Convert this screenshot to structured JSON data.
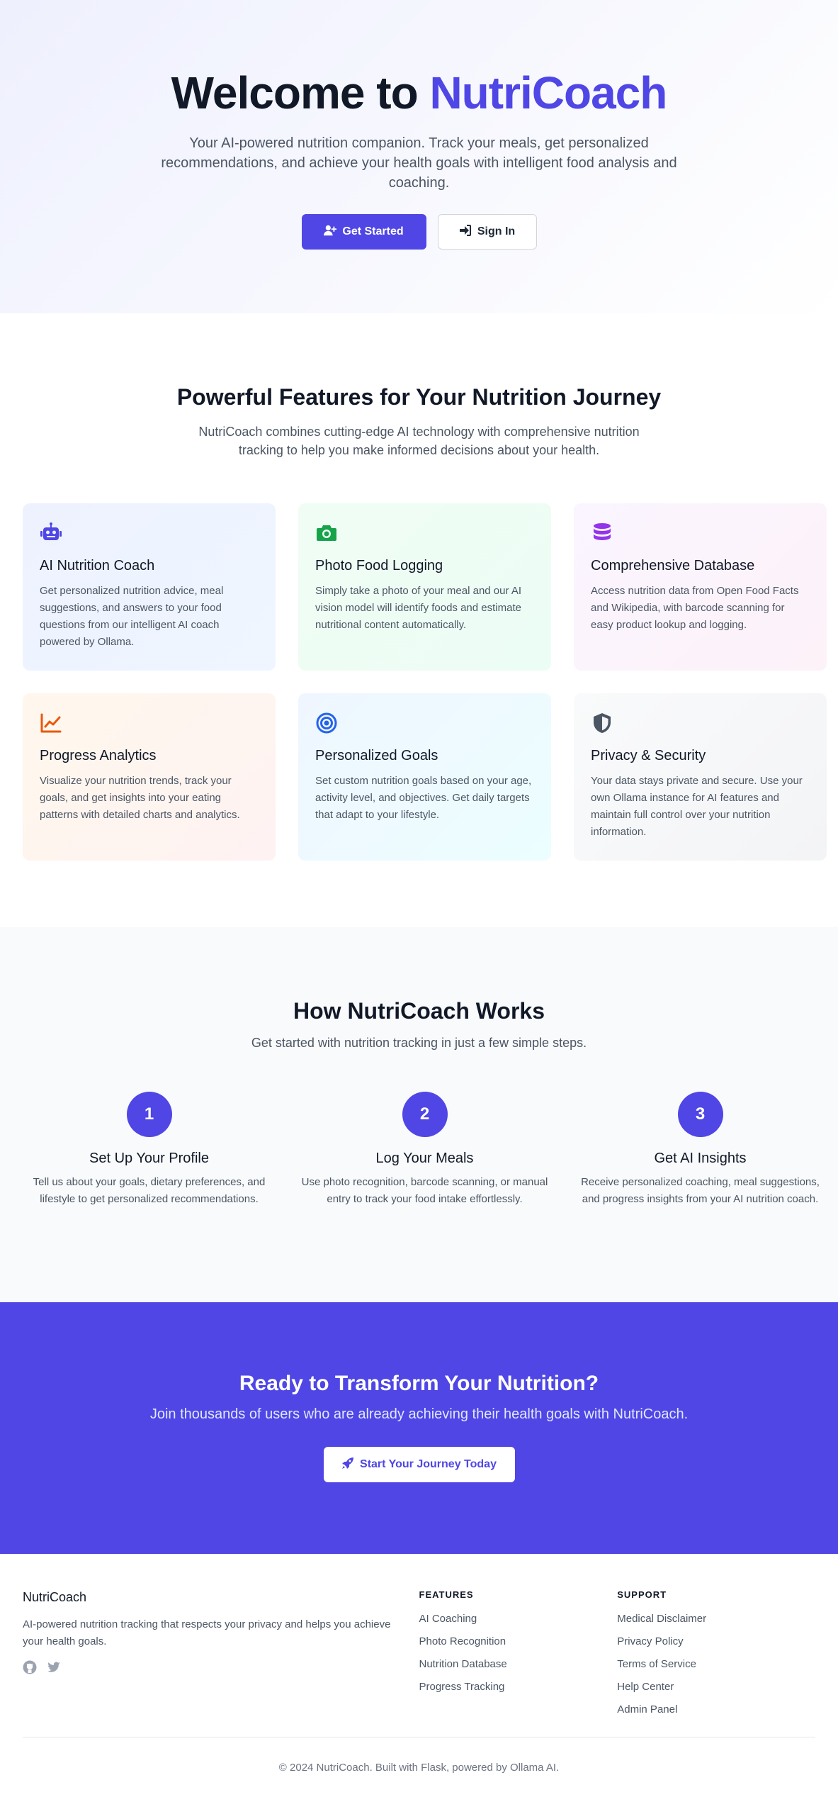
{
  "hero": {
    "title_prefix": "Welcome to ",
    "title_brand": "NutriCoach",
    "subtitle": "Your AI-powered nutrition companion. Track your meals, get personalized recommendations, and achieve your health goals with intelligent food analysis and coaching.",
    "primary_button": "Get Started",
    "secondary_button": "Sign In",
    "primary_icon": "user-plus-icon",
    "secondary_icon": "sign-in-icon"
  },
  "features": {
    "title": "Powerful Features for Your Nutrition Journey",
    "subtitle": "NutriCoach combines cutting-edge AI technology with comprehensive nutrition tracking to help you make informed decisions about your health.",
    "cards": [
      {
        "title": "AI Nutrition Coach",
        "text": "Get personalized nutrition advice, meal suggestions, and answers to your food questions from our intelligent AI coach powered by Ollama.",
        "icon": "robot-icon",
        "color": "#4f46e5"
      },
      {
        "title": "Photo Food Logging",
        "text": "Simply take a photo of your meal and our AI vision model will identify foods and estimate nutritional content automatically.",
        "icon": "camera-icon",
        "color": "#16a34a"
      },
      {
        "title": "Comprehensive Database",
        "text": "Access nutrition data from Open Food Facts and Wikipedia, with barcode scanning for easy product lookup and logging.",
        "icon": "database-icon",
        "color": "#9333ea"
      },
      {
        "title": "Progress Analytics",
        "text": "Visualize your nutrition trends, track your goals, and get insights into your eating patterns with detailed charts and analytics.",
        "icon": "chart-line-icon",
        "color": "#ea580c"
      },
      {
        "title": "Personalized Goals",
        "text": "Set custom nutrition goals based on your age, activity level, and objectives. Get daily targets that adapt to your lifestyle.",
        "icon": "target-icon",
        "color": "#2563eb"
      },
      {
        "title": "Privacy & Security",
        "text": "Your data stays private and secure. Use your own Ollama instance for AI features and maintain full control over your nutrition information.",
        "icon": "shield-icon",
        "color": "#4b5563"
      }
    ]
  },
  "how": {
    "title": "How NutriCoach Works",
    "subtitle": "Get started with nutrition tracking in just a few simple steps.",
    "steps": [
      {
        "num": "1",
        "title": "Set Up Your Profile",
        "text": "Tell us about your goals, dietary preferences, and lifestyle to get personalized recommendations."
      },
      {
        "num": "2",
        "title": "Log Your Meals",
        "text": "Use photo recognition, barcode scanning, or manual entry to track your food intake effortlessly."
      },
      {
        "num": "3",
        "title": "Get AI Insights",
        "text": "Receive personalized coaching, meal suggestions, and progress insights from your AI nutrition coach."
      }
    ]
  },
  "cta": {
    "title": "Ready to Transform Your Nutrition?",
    "subtitle": "Join thousands of users who are already achieving their health goals with NutriCoach.",
    "button": "Start Your Journey Today",
    "button_icon": "rocket-icon"
  },
  "footer": {
    "brand": "NutriCoach",
    "tagline": "AI-powered nutrition tracking that respects your privacy and helps you achieve your health goals.",
    "social_icons": [
      "github-icon",
      "twitter-icon"
    ],
    "features_heading": "FEATURES",
    "features_links": [
      "AI Coaching",
      "Photo Recognition",
      "Nutrition Database",
      "Progress Tracking"
    ],
    "support_heading": "SUPPORT",
    "support_links": [
      "Medical Disclaimer",
      "Privacy Policy",
      "Terms of Service",
      "Help Center",
      "Admin Panel"
    ],
    "copyright": "© 2024 NutriCoach. Built with Flask, powered by Ollama AI."
  },
  "colors": {
    "brand": "#4f46e5",
    "text": "#111827",
    "muted": "#4b5563"
  }
}
